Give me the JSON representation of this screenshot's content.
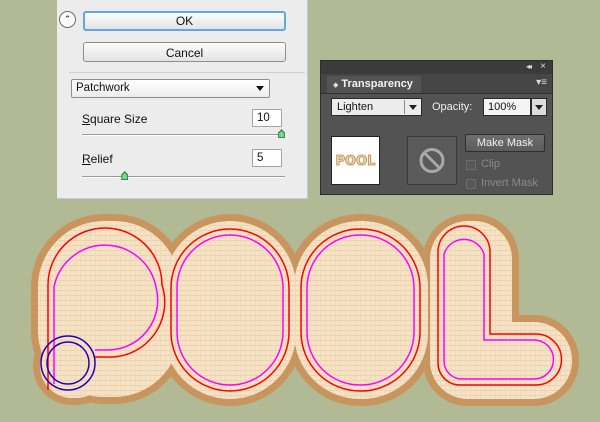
{
  "dialog": {
    "collapse_glyph": "⌃",
    "ok_label": "OK",
    "cancel_label": "Cancel",
    "filter_selected": "Patchwork",
    "square_size": {
      "label_mnemonic": "S",
      "label_rest": "quare Size",
      "value": "10",
      "slider_fraction": 1.0
    },
    "relief": {
      "label_mnemonic": "R",
      "label_rest": "elief",
      "value": "5",
      "slider_fraction": 0.2
    }
  },
  "panel": {
    "tab_label": "Transparency",
    "tab_glyph": "◆",
    "collapse_glyph": "◂◂",
    "close_glyph": "×",
    "menu_glyph": "▾≡",
    "blend_mode": "Lighten",
    "opacity_label": "Opacity:",
    "opacity_value": "100%",
    "thumbnail_text": "POOL",
    "make_mask_label": "Make Mask",
    "clip_label": "Clip",
    "invert_mask_label": "Invert Mask",
    "clip_checked": false,
    "invert_mask_checked": false
  },
  "artwork": {
    "text": "POOL",
    "fill": "#f6e3c6",
    "outline": "#c8955e",
    "guide_red": "#ff0000",
    "guide_magenta": "#ff00ff",
    "guide_blue": "#2200bb"
  },
  "icons": [
    "collapse-icon",
    "dropdown-arrow-icon",
    "slider-thumb-icon",
    "panel-menu-icon",
    "no-mask-icon",
    "collapse-panel-icon",
    "close-icon"
  ]
}
